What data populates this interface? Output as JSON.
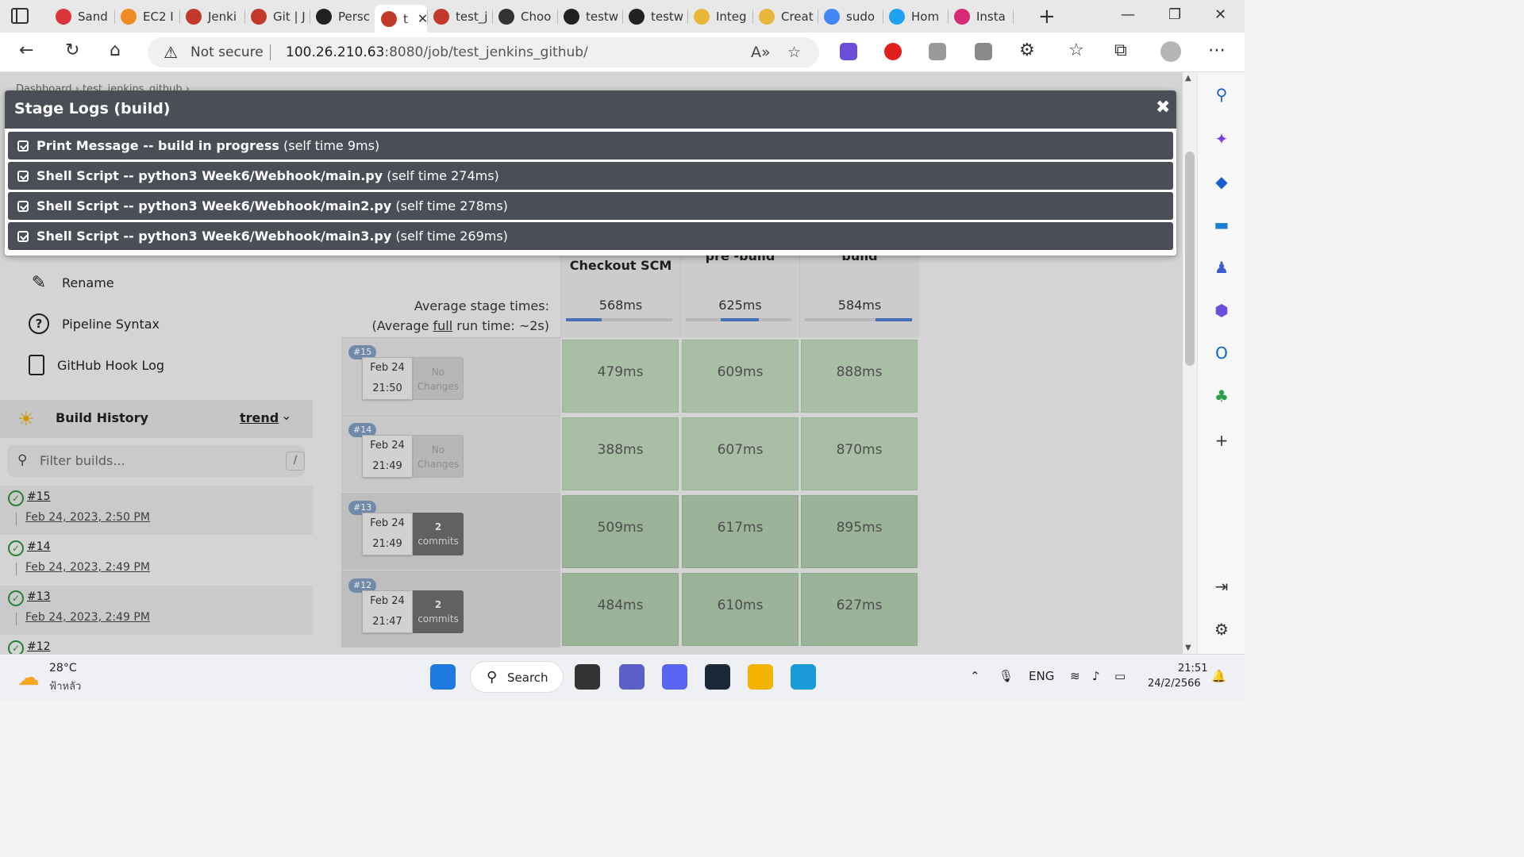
{
  "browser": {
    "tabs": [
      {
        "label": "Sand",
        "color": "#d9363e"
      },
      {
        "label": "EC2 I",
        "color": "#f08a24"
      },
      {
        "label": "Jenki",
        "color": "#c0392b"
      },
      {
        "label": "Git | J",
        "color": "#c0392b"
      },
      {
        "label": "Persc",
        "color": "#222222"
      },
      {
        "label": "t",
        "color": "#c0392b",
        "active": true
      },
      {
        "label": "test_j",
        "color": "#c0392b"
      },
      {
        "label": "Choo",
        "color": "#333333"
      },
      {
        "label": "testw",
        "color": "#222222"
      },
      {
        "label": "testw",
        "color": "#222222"
      },
      {
        "label": "Integ",
        "color": "#e8b73a"
      },
      {
        "label": "Creat",
        "color": "#e8b73a"
      },
      {
        "label": "sudo",
        "color": "#4285f4"
      },
      {
        "label": "Hom",
        "color": "#1da1f2"
      },
      {
        "label": "Insta",
        "color": "#d62976"
      }
    ],
    "security_label": "Not secure",
    "url_host": "100.26.210.63",
    "url_rest": ":8080/job/test_jenkins_github/"
  },
  "sidebar": {
    "links": [
      {
        "label": "Rename",
        "icon": "pencil-icon"
      },
      {
        "label": "Pipeline Syntax",
        "icon": "help-circle-icon"
      },
      {
        "label": "GitHub Hook Log",
        "icon": "clipboard-icon"
      }
    ],
    "build_history": {
      "title": "Build History",
      "trend_label": "trend",
      "filter_placeholder": "Filter builds...",
      "filter_shortcut": "/",
      "builds": [
        {
          "number": "#15",
          "date": "Feb 24, 2023, 2:50 PM"
        },
        {
          "number": "#14",
          "date": "Feb 24, 2023, 2:49 PM"
        },
        {
          "number": "#13",
          "date": "Feb 24, 2023, 2:49 PM"
        },
        {
          "number": "#12",
          "date": ""
        }
      ]
    }
  },
  "stage_view": {
    "stages": [
      "Checkout SCM",
      "pre -build",
      "build"
    ],
    "avg_label_line1": "Average stage times:",
    "avg_label_prefix": "(Average ",
    "avg_label_link": "full",
    "avg_label_suffix": " run time: ~2s)",
    "avg_times": [
      "568ms",
      "625ms",
      "584ms"
    ],
    "avg_fraction": [
      0.33,
      0.36,
      0.34
    ],
    "runs": [
      {
        "badge": "#15",
        "date": "Feb 24",
        "time": "21:50",
        "changes_line1": "No",
        "changes_line2": "Changes",
        "has_commits": false,
        "times": [
          "479ms",
          "609ms",
          "888ms"
        ]
      },
      {
        "badge": "#14",
        "date": "Feb 24",
        "time": "21:49",
        "changes_line1": "No",
        "changes_line2": "Changes",
        "has_commits": false,
        "times": [
          "388ms",
          "607ms",
          "870ms"
        ]
      },
      {
        "badge": "#13",
        "date": "Feb 24",
        "time": "21:49",
        "changes_line1": "2",
        "changes_line2": "commits",
        "has_commits": true,
        "times": [
          "509ms",
          "617ms",
          "895ms"
        ]
      },
      {
        "badge": "#12",
        "date": "Feb 24",
        "time": "21:47",
        "changes_line1": "2",
        "changes_line2": "commits",
        "has_commits": true,
        "times": [
          "484ms",
          "610ms",
          "627ms"
        ]
      }
    ]
  },
  "modal": {
    "title": "Stage Logs (build)",
    "close_glyph": "✖",
    "logs": [
      {
        "bold": "Print Message -- build in progress",
        "rest": " (self time 9ms)"
      },
      {
        "bold": "Shell Script -- python3 Week6/Webhook/main.py",
        "rest": " (self time 274ms)"
      },
      {
        "bold": "Shell Script -- python3 Week6/Webhook/main2.py",
        "rest": " (self time 278ms)"
      },
      {
        "bold": "Shell Script -- python3 Week6/Webhook/main3.py",
        "rest": " (self time 269ms)"
      }
    ]
  },
  "taskbar": {
    "weather_temp": "28°C",
    "weather_desc": "ฟ้าหลัว",
    "search_label": "Search",
    "lang": "ENG",
    "time": "21:51",
    "date": "24/2/2566"
  }
}
